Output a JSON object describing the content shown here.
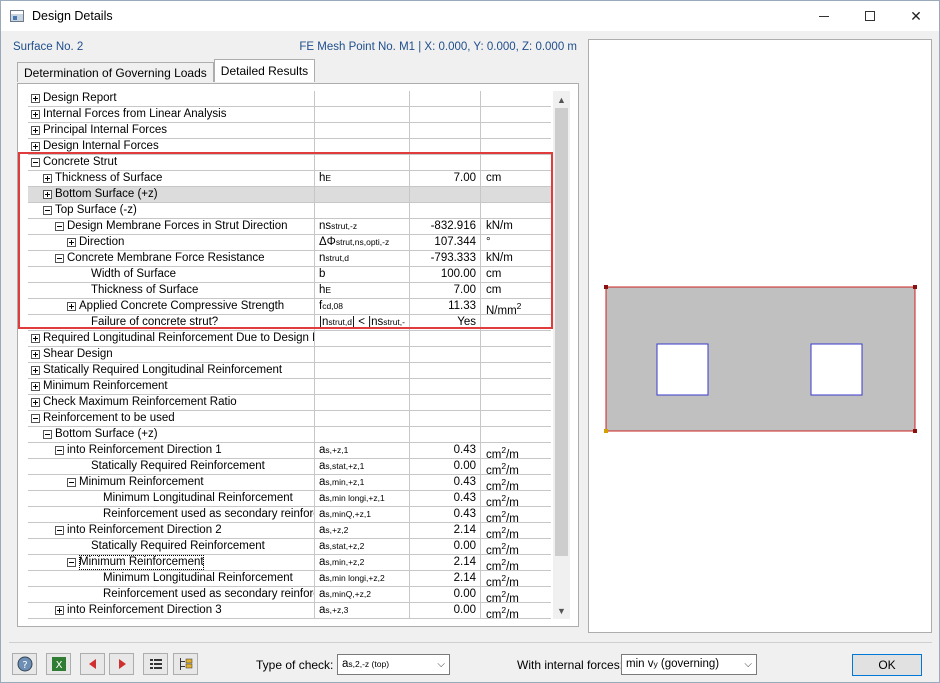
{
  "window": {
    "title": "Design Details"
  },
  "header": {
    "left": "Surface No. 2",
    "right": "FE Mesh Point No. M1  |  X: 0.000, Y: 0.000, Z: 0.000 m"
  },
  "tabs": [
    {
      "label": "Determination of Governing Loads"
    },
    {
      "label": "Detailed Results"
    }
  ],
  "rows": [
    {
      "label": "Design Report",
      "indent": 0,
      "toggle": "plus"
    },
    {
      "label": "Internal Forces from Linear Analysis",
      "indent": 0,
      "toggle": "plus"
    },
    {
      "label": "Principal Internal Forces",
      "indent": 0,
      "toggle": "plus"
    },
    {
      "label": "Design Internal Forces",
      "indent": 0,
      "toggle": "plus"
    },
    {
      "label": "Concrete Strut",
      "indent": 0,
      "toggle": "minus"
    },
    {
      "label": "Thickness of Surface",
      "indent": 1,
      "toggle": "plus",
      "sym": "h",
      "sub": "E",
      "value": "7.00",
      "unit": "cm"
    },
    {
      "label": "Bottom Surface (+z)",
      "indent": 1,
      "toggle": "plus",
      "shaded": true
    },
    {
      "label": "Top Surface (-z)",
      "indent": 1,
      "toggle": "minus"
    },
    {
      "label": "Design Membrane Forces in Strut Direction",
      "indent": 2,
      "toggle": "minus",
      "sym": "ns",
      "sub": "strut,-z",
      "value": "-832.916",
      "unit": "kN/m"
    },
    {
      "label": "Direction",
      "indent": 3,
      "toggle": "plus",
      "sym": "ΔΦ",
      "sub": "strut,ns,opti,-z",
      "value": "107.344",
      "unit": "°"
    },
    {
      "label": "Concrete Membrane Force Resistance",
      "indent": 2,
      "toggle": "minus",
      "sym": "n",
      "sub": "strut,d",
      "value": "-793.333",
      "unit": "kN/m"
    },
    {
      "label": "Width of Surface",
      "indent": 4,
      "toggle": "none",
      "sym": "b",
      "sub": "",
      "value": "100.00",
      "unit": "cm"
    },
    {
      "label": "Thickness of Surface",
      "indent": 4,
      "toggle": "none",
      "sym": "h",
      "sub": "E",
      "value": "7.00",
      "unit": "cm"
    },
    {
      "label": "Applied Concrete Compressive Strength",
      "indent": 3,
      "toggle": "plus",
      "sym": "f",
      "sub": "cd,08",
      "value": "11.33",
      "unit": "N/mm",
      "unit_sup": "2"
    },
    {
      "label": "Failure of concrete strut?",
      "indent": 4,
      "toggle": "none",
      "sym": "|n",
      "sub": "strut,d",
      "sym2": "| < |ns",
      "sub2": "strut,-",
      "value": "Yes",
      "unit": ""
    },
    {
      "label": "Required Longitudinal Reinforcement Due to Design Membrane Forces",
      "indent": 0,
      "toggle": "plus"
    },
    {
      "label": "Shear Design",
      "indent": 0,
      "toggle": "plus"
    },
    {
      "label": "Statically Required Longitudinal Reinforcement",
      "indent": 0,
      "toggle": "plus"
    },
    {
      "label": "Minimum Reinforcement",
      "indent": 0,
      "toggle": "plus"
    },
    {
      "label": "Check Maximum Reinforcement Ratio",
      "indent": 0,
      "toggle": "plus"
    },
    {
      "label": "Reinforcement to be used",
      "indent": 0,
      "toggle": "minus"
    },
    {
      "label": "Bottom Surface (+z)",
      "indent": 1,
      "toggle": "minus"
    },
    {
      "label": "into Reinforcement Direction 1",
      "indent": 2,
      "toggle": "minus",
      "sym": "a",
      "sub": "s,+z,1",
      "value": "0.43",
      "unit": "cm",
      "unit_sup": "2",
      "unit_tail": "/m"
    },
    {
      "label": "Statically Required Reinforcement",
      "indent": 4,
      "toggle": "none",
      "sym": "a",
      "sub": "s,stat,+z,1",
      "value": "0.00",
      "unit": "cm",
      "unit_sup": "2",
      "unit_tail": "/m"
    },
    {
      "label": "Minimum Reinforcement",
      "indent": 3,
      "toggle": "minus",
      "sym": "a",
      "sub": "s,min,+z,1",
      "value": "0.43",
      "unit": "cm",
      "unit_sup": "2",
      "unit_tail": "/m"
    },
    {
      "label": "Minimum Longitudinal Reinforcement",
      "indent": 5,
      "toggle": "none",
      "sym": "a",
      "sub": "s,min longi,+z,1",
      "value": "0.43",
      "unit": "cm",
      "unit_sup": "2",
      "unit_tail": "/m"
    },
    {
      "label": "Reinforcement used as secondary reinforcement",
      "indent": 5,
      "toggle": "none",
      "sym": "a",
      "sub": "s,minQ,+z,1",
      "value": "0.43",
      "unit": "cm",
      "unit_sup": "2",
      "unit_tail": "/m"
    },
    {
      "label": "into Reinforcement Direction 2",
      "indent": 2,
      "toggle": "minus",
      "sym": "a",
      "sub": "s,+z,2",
      "value": "2.14",
      "unit": "cm",
      "unit_sup": "2",
      "unit_tail": "/m"
    },
    {
      "label": "Statically Required Reinforcement",
      "indent": 4,
      "toggle": "none",
      "sym": "a",
      "sub": "s,stat,+z,2",
      "value": "0.00",
      "unit": "cm",
      "unit_sup": "2",
      "unit_tail": "/m"
    },
    {
      "label": "Minimum Reinforcement",
      "indent": 3,
      "toggle": "minus",
      "sym": "a",
      "sub": "s,min,+z,2",
      "value": "2.14",
      "unit": "cm",
      "unit_sup": "2",
      "unit_tail": "/m",
      "focus": true
    },
    {
      "label": "Minimum Longitudinal Reinforcement",
      "indent": 5,
      "toggle": "none",
      "sym": "a",
      "sub": "s,min longi,+z,2",
      "value": "2.14",
      "unit": "cm",
      "unit_sup": "2",
      "unit_tail": "/m"
    },
    {
      "label": "Reinforcement used as secondary reinforcement",
      "indent": 5,
      "toggle": "none",
      "sym": "a",
      "sub": "s,minQ,+z,2",
      "value": "0.00",
      "unit": "cm",
      "unit_sup": "2",
      "unit_tail": "/m"
    },
    {
      "label": "into Reinforcement Direction 3",
      "indent": 2,
      "toggle": "plus",
      "sym": "a",
      "sub": "s,+z,3",
      "value": "0.00",
      "unit": "cm",
      "unit_sup": "2",
      "unit_tail": "/m"
    }
  ],
  "bottom": {
    "type_of_check_label": "Type of check:",
    "type_of_check_value": "a",
    "type_of_check_sub": "s,2,-z (top)",
    "forces_label": "With internal forces:",
    "forces_value": "min v",
    "forces_sub": "y",
    "forces_tail": " (governing)",
    "ok_label": "OK"
  },
  "colors": {
    "highlight": "#e03c3c",
    "header_text": "#1f4e8c",
    "surface_fill": "#c0c0c0",
    "surface_border": "#cc2222",
    "opening_border": "#3a3acc"
  },
  "icons": [
    "help-icon",
    "excel-icon",
    "previous-icon",
    "next-icon",
    "list-icon",
    "tree-icon"
  ]
}
